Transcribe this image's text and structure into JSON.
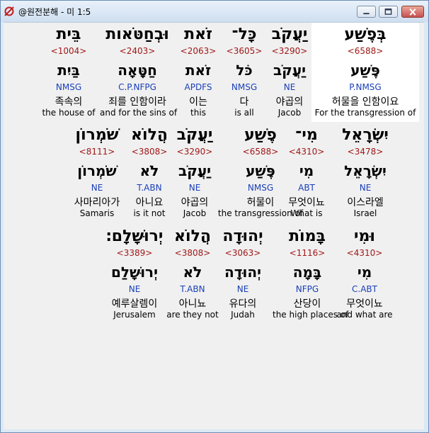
{
  "window": {
    "title": "@원전분해 - 미 1:5",
    "app_icon": "ring-app-icon",
    "buttons": {
      "minimize": "minimize-icon",
      "maximize": "maximize-icon",
      "close": "close-icon"
    }
  },
  "colors": {
    "strong": "#a01818",
    "morph": "#1a3fb8",
    "selection": "#ffffff"
  },
  "lines": [
    {
      "words": [
        {
          "hebrew": "בְּפֶשַׁע",
          "strong": "<6588>",
          "lemma": "פֶּשַׁע",
          "morph": "P.NMSG",
          "korean": "허물을 인함이요",
          "english": "For the transgression of",
          "selected": true
        },
        {
          "hebrew": "יַעֲקֹב",
          "strong": "<3290>",
          "lemma": "יַעֲקֹב",
          "morph": "NE",
          "korean": "야곱의",
          "english": "Jacob"
        },
        {
          "hebrew": "כָּל־",
          "strong": "<3605>",
          "lemma": "כֹּל",
          "morph": "NMSG",
          "korean": "다",
          "english": "is all"
        },
        {
          "hebrew": "זֹאת",
          "strong": "<2063>",
          "lemma": "זֹאת",
          "morph": "APDFS",
          "korean": "이는",
          "english": "this"
        },
        {
          "hebrew": "וּבְחַטֹּאות",
          "strong": "<2403>",
          "lemma": "חַטָּאָה",
          "morph": "C.P.NFPG",
          "korean": "죄를 인함이라",
          "english": "and for the sins of"
        },
        {
          "hebrew": "בֵּית",
          "strong": "<1004>",
          "lemma": "בַּיִת",
          "morph": "NMSG",
          "korean": "족속의",
          "english": "the house of"
        }
      ]
    },
    {
      "words": [
        {
          "hebrew": "יִשְׂרָאֵל",
          "strong": "<3478>",
          "lemma": "יִשְׂרָאֵל",
          "morph": "NE",
          "korean": "이스라엘",
          "english": "Israel"
        },
        {
          "hebrew": "מִי־",
          "strong": "<4310>",
          "lemma": "מִי",
          "morph": "ABT",
          "korean": "무엇이뇨",
          "english": "What is"
        },
        {
          "hebrew": "פֶשַׁע",
          "strong": "<6588>",
          "lemma": "פֶּשַׁע",
          "morph": "NMSG",
          "korean": "허물이",
          "english": "the transgression of"
        },
        {
          "hebrew": "יַעֲקֹב",
          "strong": "<3290>",
          "lemma": "יַעֲקֹב",
          "morph": "NE",
          "korean": "야곱의",
          "english": "Jacob"
        },
        {
          "hebrew": "הֲלוֹא",
          "strong": "<3808>",
          "lemma": "לֹא",
          "morph": "T.ABN",
          "korean": "아니요",
          "english": "is it not"
        },
        {
          "hebrew": "שֹׁמְרוֹן",
          "strong": "<8111>",
          "lemma": "שֹׁמְרוֹן",
          "morph": "NE",
          "korean": "사마리아가",
          "english": "Samaris"
        }
      ]
    },
    {
      "words": [
        {
          "hebrew": "וּמִי",
          "strong": "<4310>",
          "lemma": "מִי",
          "morph": "C.ABT",
          "korean": "무엇이뇨",
          "english": "and what are"
        },
        {
          "hebrew": "בָּמוֹת",
          "strong": "<1116>",
          "lemma": "בָּמָה",
          "morph": "NFPG",
          "korean": "산당이",
          "english": "the high places of"
        },
        {
          "hebrew": "יְהוּדָה",
          "strong": "<3063>",
          "lemma": "יְהוּדָה",
          "morph": "NE",
          "korean": "유다의",
          "english": "Judah"
        },
        {
          "hebrew": "הֲלוֹא",
          "strong": "<3808>",
          "lemma": "לֹא",
          "morph": "T.ABN",
          "korean": "아니뇨",
          "english": "are they not"
        },
        {
          "hebrew": "יְרוּשָׁלִָם׃",
          "strong": "<3389>",
          "lemma": "יְרוּשָׁלִַם",
          "morph": "NE",
          "korean": "예루살렘이",
          "english": "Jerusalem"
        }
      ]
    }
  ]
}
